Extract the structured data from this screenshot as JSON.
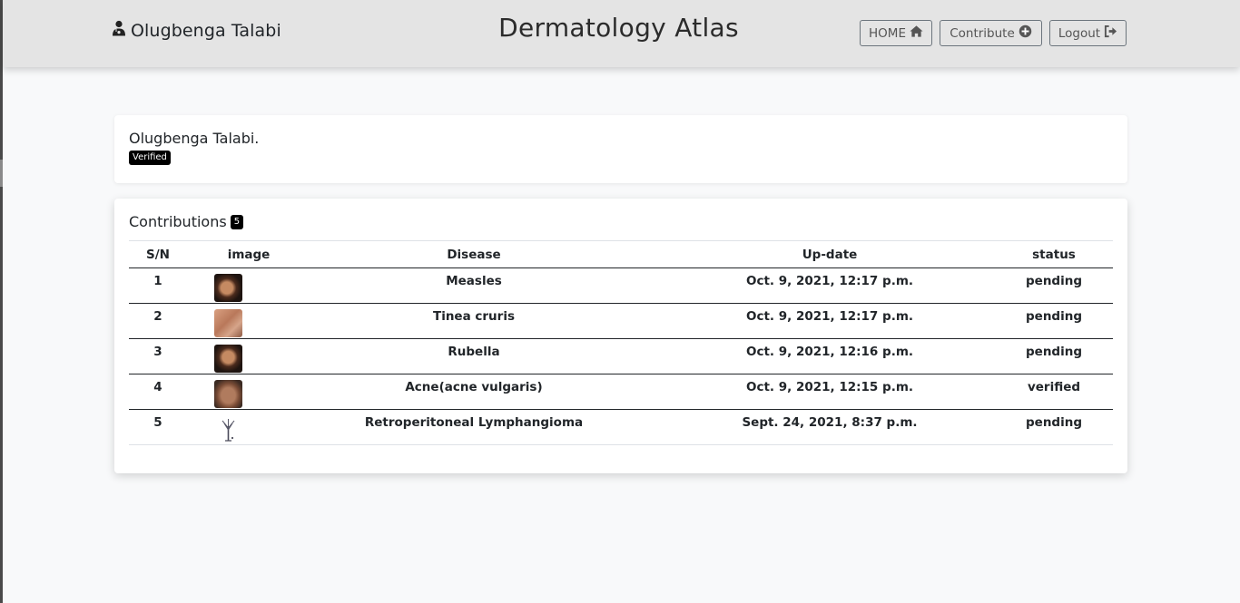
{
  "header": {
    "user_name": "Olugbenga Talabi",
    "title": "Dermatology Atlas",
    "nav": {
      "home": "HOME",
      "contribute": "Contribute",
      "logout": "Logout"
    }
  },
  "profile": {
    "name": "Olugbenga Talabi.",
    "status_badge": "Verified"
  },
  "contributions": {
    "title": "Contributions",
    "count": "5",
    "columns": [
      "S/N",
      "image",
      "Disease",
      "Up-date",
      "status"
    ],
    "rows": [
      {
        "sn": "1",
        "disease": "Measles",
        "date": "Oct. 9, 2021, 12:17 p.m.",
        "status": "pending"
      },
      {
        "sn": "2",
        "disease": "Tinea cruris",
        "date": "Oct. 9, 2021, 12:17 p.m.",
        "status": "pending"
      },
      {
        "sn": "3",
        "disease": "Rubella",
        "date": "Oct. 9, 2021, 12:16 p.m.",
        "status": "pending"
      },
      {
        "sn": "4",
        "disease": "Acne(acne vulgaris)",
        "date": "Oct. 9, 2021, 12:15 p.m.",
        "status": "verified"
      },
      {
        "sn": "5",
        "disease": "Retroperitoneal Lymphangioma",
        "date": "Sept. 24, 2021, 8:37 p.m.",
        "status": "pending"
      }
    ]
  },
  "colors": {
    "header_bg": "#e4e4e4",
    "page_bg": "#f8f9fa",
    "badge_bg": "#000000"
  }
}
